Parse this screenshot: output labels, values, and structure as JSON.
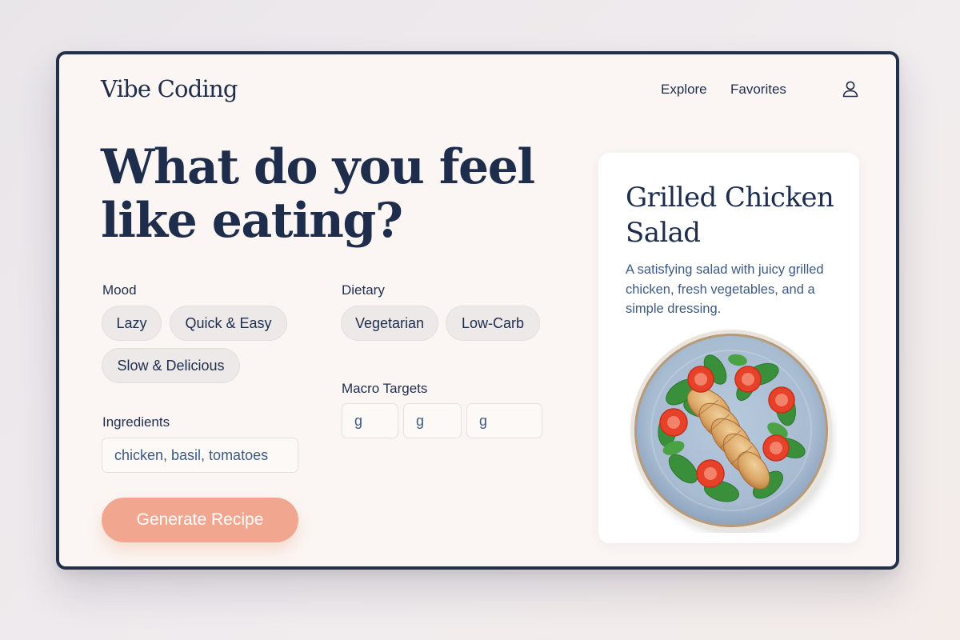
{
  "app": {
    "logo": "Vibe Coding"
  },
  "nav": {
    "explore": "Explore",
    "favorites": "Favorites",
    "user_icon": "user-icon"
  },
  "hero": {
    "headline": "What do you feel like eating?"
  },
  "mood": {
    "label": "Mood",
    "options": [
      "Lazy",
      "Quick & Easy",
      "Slow & Delicious"
    ]
  },
  "dietary": {
    "label": "Dietary",
    "options": [
      "Vegetarian",
      "Low-Carb"
    ]
  },
  "macros": {
    "label": "Macro Targets",
    "fields": [
      {
        "value": "g"
      },
      {
        "value": "g"
      },
      {
        "value": "g"
      }
    ]
  },
  "ingredients": {
    "label": "Ingredients",
    "value": "chicken, basil, tomatoes"
  },
  "actions": {
    "generate": "Generate Recipe"
  },
  "recipe_card": {
    "title": "Grilled Chicken Salad",
    "description": "A satisfying salad with juicy grilled chicken, fresh vegetables, and a simple dressing.",
    "image_icon": "salad-plate-image"
  },
  "colors": {
    "primary_text": "#1f2d4c",
    "accent": "#f1a78f",
    "muted_text": "#3c5a82",
    "chip_bg": "#ece9e8",
    "window_bg": "#fbf6f3",
    "frame": "#23304a"
  }
}
